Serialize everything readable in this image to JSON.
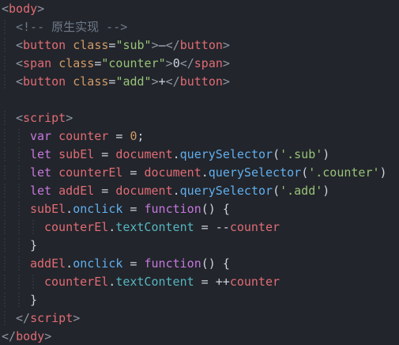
{
  "editor": {
    "background": "#22252b",
    "colors": {
      "tag": "#e06c75",
      "bracket": "#8f96a3",
      "attr": "#d19a66",
      "string": "#98c379",
      "comment": "#6f7b8a",
      "keyword": "#c678dd",
      "variable": "#e06c75",
      "number": "#d19a66",
      "text": "#cdd3de",
      "function": "#61afef",
      "property": "#56b6c2"
    },
    "lines": [
      {
        "indent": 0,
        "tokens": [
          [
            "bracket",
            "<"
          ],
          [
            "tag",
            "body"
          ],
          [
            "bracket",
            ">"
          ]
        ]
      },
      {
        "indent": 1,
        "tokens": [
          [
            "comment",
            "<!-- 原生实现 -->"
          ]
        ]
      },
      {
        "indent": 1,
        "tokens": [
          [
            "bracket",
            "<"
          ],
          [
            "tag",
            "button"
          ],
          [
            "text",
            " "
          ],
          [
            "attr",
            "class"
          ],
          [
            "text",
            "="
          ],
          [
            "string",
            "\"sub\""
          ],
          [
            "bracket",
            ">"
          ],
          [
            "text",
            "—"
          ],
          [
            "bracket",
            "</"
          ],
          [
            "tag",
            "button"
          ],
          [
            "bracket",
            ">"
          ]
        ]
      },
      {
        "indent": 1,
        "tokens": [
          [
            "bracket",
            "<"
          ],
          [
            "tag",
            "span"
          ],
          [
            "text",
            " "
          ],
          [
            "attr",
            "class"
          ],
          [
            "text",
            "="
          ],
          [
            "string",
            "\"counter\""
          ],
          [
            "bracket",
            ">"
          ],
          [
            "text",
            "0"
          ],
          [
            "bracket",
            "</"
          ],
          [
            "tag",
            "span"
          ],
          [
            "bracket",
            ">"
          ]
        ]
      },
      {
        "indent": 1,
        "tokens": [
          [
            "bracket",
            "<"
          ],
          [
            "tag",
            "button"
          ],
          [
            "text",
            " "
          ],
          [
            "attr",
            "class"
          ],
          [
            "text",
            "="
          ],
          [
            "string",
            "\"add\""
          ],
          [
            "bracket",
            ">"
          ],
          [
            "text",
            "+"
          ],
          [
            "bracket",
            "</"
          ],
          [
            "tag",
            "button"
          ],
          [
            "bracket",
            ">"
          ]
        ]
      },
      {
        "indent": 0,
        "tokens": []
      },
      {
        "indent": 1,
        "tokens": [
          [
            "bracket",
            "<"
          ],
          [
            "tag",
            "script"
          ],
          [
            "bracket",
            ">"
          ]
        ]
      },
      {
        "indent": 2,
        "tokens": [
          [
            "keyword",
            "var"
          ],
          [
            "text",
            " "
          ],
          [
            "variable",
            "counter"
          ],
          [
            "text",
            " = "
          ],
          [
            "number",
            "0"
          ],
          [
            "text",
            ";"
          ]
        ]
      },
      {
        "indent": 2,
        "tokens": [
          [
            "keyword",
            "let"
          ],
          [
            "text",
            " "
          ],
          [
            "variable",
            "subEl"
          ],
          [
            "text",
            " = "
          ],
          [
            "variable",
            "document"
          ],
          [
            "text",
            "."
          ],
          [
            "function",
            "querySelector"
          ],
          [
            "text",
            "("
          ],
          [
            "string",
            "'.sub'"
          ],
          [
            "text",
            ")"
          ]
        ]
      },
      {
        "indent": 2,
        "tokens": [
          [
            "keyword",
            "let"
          ],
          [
            "text",
            " "
          ],
          [
            "variable",
            "counterEl"
          ],
          [
            "text",
            " = "
          ],
          [
            "variable",
            "document"
          ],
          [
            "text",
            "."
          ],
          [
            "function",
            "querySelector"
          ],
          [
            "text",
            "("
          ],
          [
            "string",
            "'.counter'"
          ],
          [
            "text",
            ")"
          ]
        ]
      },
      {
        "indent": 2,
        "tokens": [
          [
            "keyword",
            "let"
          ],
          [
            "text",
            " "
          ],
          [
            "variable",
            "addEl"
          ],
          [
            "text",
            " = "
          ],
          [
            "variable",
            "document"
          ],
          [
            "text",
            "."
          ],
          [
            "function",
            "querySelector"
          ],
          [
            "text",
            "("
          ],
          [
            "string",
            "'.add'"
          ],
          [
            "text",
            ")"
          ]
        ]
      },
      {
        "indent": 2,
        "tokens": [
          [
            "variable",
            "subEl"
          ],
          [
            "text",
            "."
          ],
          [
            "function",
            "onclick"
          ],
          [
            "text",
            " = "
          ],
          [
            "keyword",
            "function"
          ],
          [
            "text",
            "() {"
          ]
        ]
      },
      {
        "indent": 3,
        "tokens": [
          [
            "variable",
            "counterEl"
          ],
          [
            "text",
            "."
          ],
          [
            "property",
            "textContent"
          ],
          [
            "text",
            " = --"
          ],
          [
            "variable",
            "counter"
          ]
        ]
      },
      {
        "indent": 2,
        "tokens": [
          [
            "text",
            "}"
          ]
        ]
      },
      {
        "indent": 2,
        "tokens": [
          [
            "variable",
            "addEl"
          ],
          [
            "text",
            "."
          ],
          [
            "function",
            "onclick"
          ],
          [
            "text",
            " = "
          ],
          [
            "keyword",
            "function"
          ],
          [
            "text",
            "() {"
          ]
        ]
      },
      {
        "indent": 3,
        "tokens": [
          [
            "variable",
            "counterEl"
          ],
          [
            "text",
            "."
          ],
          [
            "property",
            "textContent"
          ],
          [
            "text",
            " = ++"
          ],
          [
            "variable",
            "counter"
          ]
        ]
      },
      {
        "indent": 2,
        "tokens": [
          [
            "text",
            "}"
          ]
        ]
      },
      {
        "indent": 1,
        "tokens": [
          [
            "bracket",
            "</"
          ],
          [
            "tag",
            "script"
          ],
          [
            "bracket",
            ">"
          ]
        ]
      },
      {
        "indent": 0,
        "tokens": [
          [
            "bracket",
            "</"
          ],
          [
            "tag",
            "body"
          ],
          [
            "bracket",
            ">"
          ]
        ]
      }
    ]
  }
}
